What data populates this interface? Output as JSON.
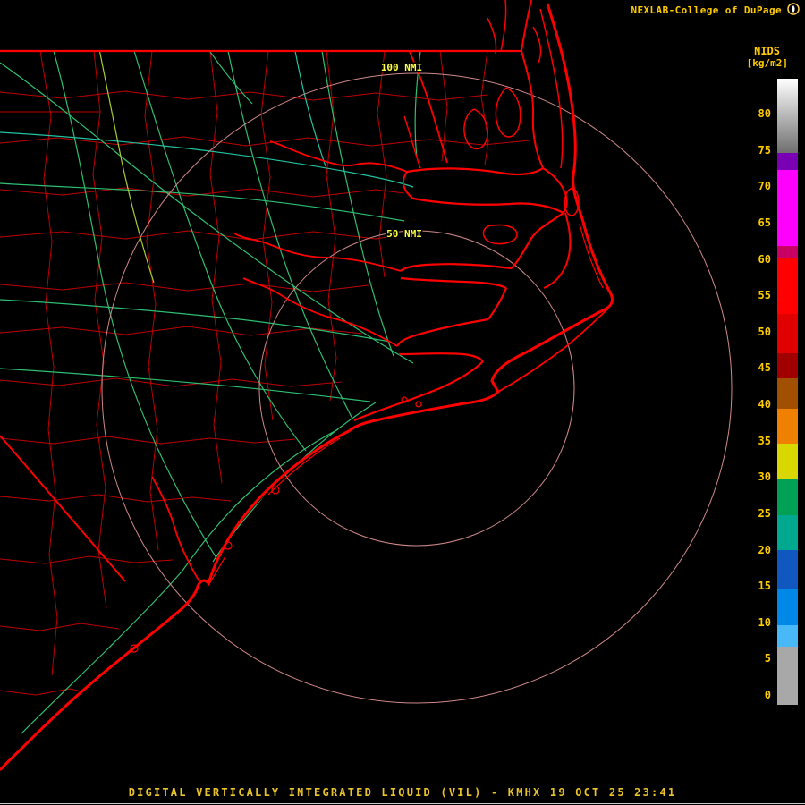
{
  "header": {
    "brand": "NEXLAB-College of DuPage"
  },
  "colorbar": {
    "title": "NIDS",
    "units": "[kg/m2]",
    "ticks": [
      80,
      75,
      70,
      65,
      60,
      55,
      50,
      45,
      40,
      35,
      30,
      25,
      20,
      15,
      10,
      5,
      0
    ],
    "segments": [
      {
        "hi": 84.8,
        "lo": 74.6,
        "color": "#ffffff",
        "color2": "#6f6f6f"
      },
      {
        "hi": 74.6,
        "lo": 72.2,
        "color": "#7a00b4"
      },
      {
        "hi": 72.2,
        "lo": 61.8,
        "color": "#ff00ff"
      },
      {
        "hi": 61.8,
        "lo": 60.2,
        "color": "#c80064"
      },
      {
        "hi": 60.2,
        "lo": 52.4,
        "color": "#ff0000"
      },
      {
        "hi": 52.4,
        "lo": 47.0,
        "color": "#e00000"
      },
      {
        "hi": 47.0,
        "lo": 43.6,
        "color": "#a00000"
      },
      {
        "hi": 43.6,
        "lo": 39.4,
        "color": "#a05000"
      },
      {
        "hi": 39.4,
        "lo": 34.6,
        "color": "#f08000"
      },
      {
        "hi": 34.6,
        "lo": 29.8,
        "color": "#d8d800"
      },
      {
        "hi": 29.8,
        "lo": 24.8,
        "color": "#00a055"
      },
      {
        "hi": 24.8,
        "lo": 19.9,
        "color": "#00a890"
      },
      {
        "hi": 19.9,
        "lo": 14.7,
        "color": "#1058c0"
      },
      {
        "hi": 14.7,
        "lo": 9.6,
        "color": "#0088e8"
      },
      {
        "hi": 9.6,
        "lo": 6.7,
        "color": "#48b8f8"
      },
      {
        "hi": 6.7,
        "lo": -1.3,
        "color": "#a8a8a8"
      }
    ]
  },
  "map": {
    "range_rings": [
      {
        "label": "100 NMI",
        "radius_px": 352
      },
      {
        "label": "50 NMI",
        "radius_px": 176
      }
    ],
    "colors": {
      "boundary": "#ff0000",
      "county": "#c80000",
      "road": "#2fbf71",
      "road_alt": "#22c2a2",
      "interstate": "#a8cc33",
      "range_ring": "#d18989",
      "label": "#ffff44"
    }
  },
  "footer": {
    "title": "DIGITAL VERTICALLY INTEGRATED LIQUID (VIL) - KMHX 19 OCT 25 23:41"
  },
  "theme": {
    "background": "#000000",
    "text": "#ffcc00",
    "footer_rule": "#c8c8c8"
  }
}
